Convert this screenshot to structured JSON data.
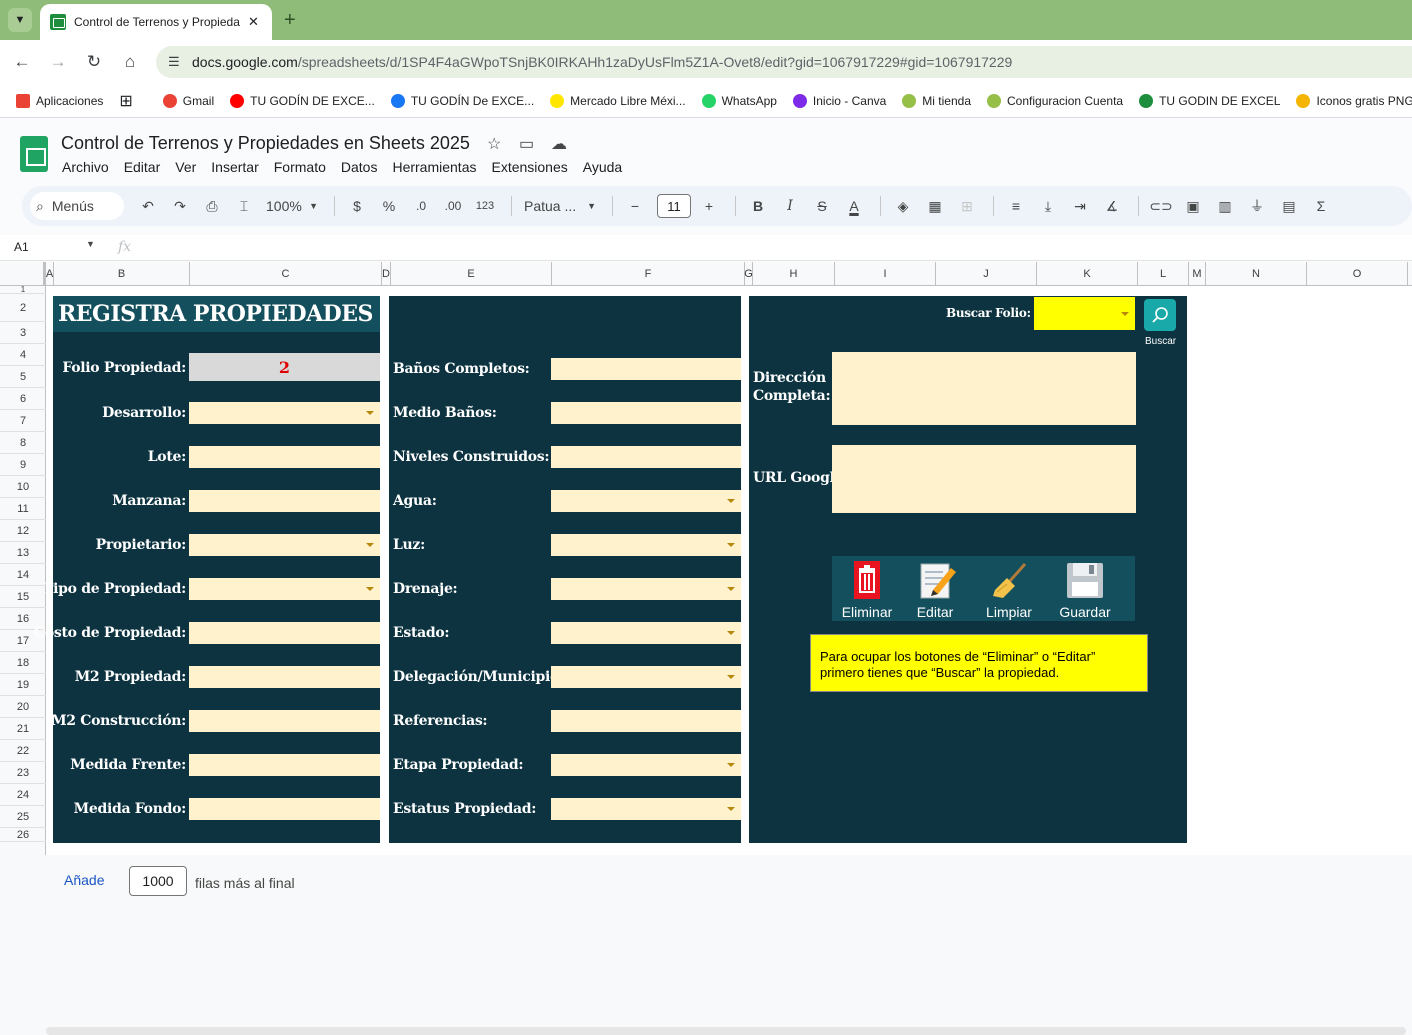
{
  "browser": {
    "tab_title": "Control de Terrenos y Propiedad",
    "tab_close": "✕",
    "new_tab": "+",
    "url_host": "docs.google.com",
    "url_path": "/spreadsheets/d/1SP4F4aGWpoTSnjBK0IRKAHh1zaDyUsFlm5Z1A-Ovet8/edit?gid=1067917229#gid=1067917229",
    "bookmarks": [
      {
        "label": "Aplicaciones",
        "color": "#ea4335"
      },
      {
        "label": "Gmail",
        "color": "#ea4335"
      },
      {
        "label": "TU GODÍN DE EXCE...",
        "color": "#ff0000"
      },
      {
        "label": "TU GODÍN De EXCE...",
        "color": "#1877f2"
      },
      {
        "label": "Mercado Libre Méxi...",
        "color": "#ffe600"
      },
      {
        "label": "WhatsApp",
        "color": "#25d366"
      },
      {
        "label": "Inicio - Canva",
        "color": "#7d2ae8"
      },
      {
        "label": "Mi tienda",
        "color": "#95bf47"
      },
      {
        "label": "Configuracion Cuenta",
        "color": "#95bf47"
      },
      {
        "label": "TU GODIN DE EXCEL",
        "color": "#1e8e3e"
      },
      {
        "label": "Iconos gratis PNG,",
        "color": "#f4b400"
      }
    ]
  },
  "sheets": {
    "doc_title": "Control de Terrenos y Propiedades en Sheets 2025",
    "menu": [
      "Archivo",
      "Editar",
      "Ver",
      "Insertar",
      "Formato",
      "Datos",
      "Herramientas",
      "Extensiones",
      "Ayuda"
    ],
    "toolbar": {
      "menus_label": "Menús",
      "zoom": "100%",
      "currency": "$",
      "percent": "%",
      "dec_decrease": ".0",
      "dec_increase": ".00",
      "number_format": "123",
      "font": "Patua ...",
      "font_size": "11",
      "bold": "B",
      "italic": "I",
      "strike": "S",
      "text_color": "A",
      "sum": "Σ"
    },
    "name_box": "A1",
    "fx": "fx",
    "columns": [
      "A",
      "B",
      "C",
      "D",
      "E",
      "F",
      "G",
      "H",
      "I",
      "J",
      "K",
      "L",
      "M",
      "N",
      "O"
    ],
    "rows": [
      "1",
      "2",
      "3",
      "4",
      "5",
      "6",
      "7",
      "8",
      "9",
      "10",
      "11",
      "12",
      "13",
      "14",
      "15",
      "16",
      "17",
      "18",
      "19",
      "20",
      "21",
      "22",
      "23",
      "24",
      "25",
      "26"
    ],
    "add_rows_link": "Añade",
    "add_rows_value": "1000",
    "add_rows_suffix": "filas más al final"
  },
  "form": {
    "title": "REGISTRA PROPIEDADES",
    "folio_label": "Folio Propiedad:",
    "folio_value": "2",
    "left_fields": [
      {
        "label": "Desarrollo:",
        "dropdown": true
      },
      {
        "label": "Lote:",
        "dropdown": false
      },
      {
        "label": "Manzana:",
        "dropdown": false
      },
      {
        "label": "Propietario:",
        "dropdown": true
      },
      {
        "label": "Tipo de Propiedad:",
        "dropdown": true
      },
      {
        "label": "Costo de Propiedad:",
        "dropdown": false
      },
      {
        "label": "M2 Propiedad:",
        "dropdown": false
      },
      {
        "label": "M2 Construcción:",
        "dropdown": false
      },
      {
        "label": "Medida Frente:",
        "dropdown": false
      },
      {
        "label": "Medida Fondo:",
        "dropdown": false
      }
    ],
    "middle_fields": [
      {
        "label": "Baños Completos:",
        "dropdown": false
      },
      {
        "label": "Medio Baños:",
        "dropdown": false
      },
      {
        "label": "Niveles Construidos:",
        "dropdown": false
      },
      {
        "label": "Agua:",
        "dropdown": true
      },
      {
        "label": "Luz:",
        "dropdown": true
      },
      {
        "label": "Drenaje:",
        "dropdown": true
      },
      {
        "label": "Estado:",
        "dropdown": true
      },
      {
        "label": "Delegación/Municipio:",
        "dropdown": true
      },
      {
        "label": "Referencias:",
        "dropdown": false
      },
      {
        "label": "Etapa Propiedad:",
        "dropdown": true
      },
      {
        "label": "Estatus Propiedad:",
        "dropdown": true
      }
    ],
    "search_label": "Buscar Folio:",
    "search_button": "Buscar",
    "address_label_1": "Dirección",
    "address_label_2": "Completa:",
    "url_label": "URL Google:",
    "actions": [
      {
        "label": "Eliminar",
        "icon": "trash-icon"
      },
      {
        "label": "Editar",
        "icon": "edit-pencil-icon"
      },
      {
        "label": "Limpiar",
        "icon": "broom-icon"
      },
      {
        "label": "Guardar",
        "icon": "floppy-disk-icon"
      }
    ],
    "note": "Para ocupar los botones de “Eliminar” o “Editar” primero tienes que “Buscar” la propiedad."
  },
  "colors": {
    "panel": "#0d3340",
    "banner": "#134f5c",
    "field": "#fff2cc",
    "highlight": "#ffff00",
    "folio_text": "#e00000"
  }
}
